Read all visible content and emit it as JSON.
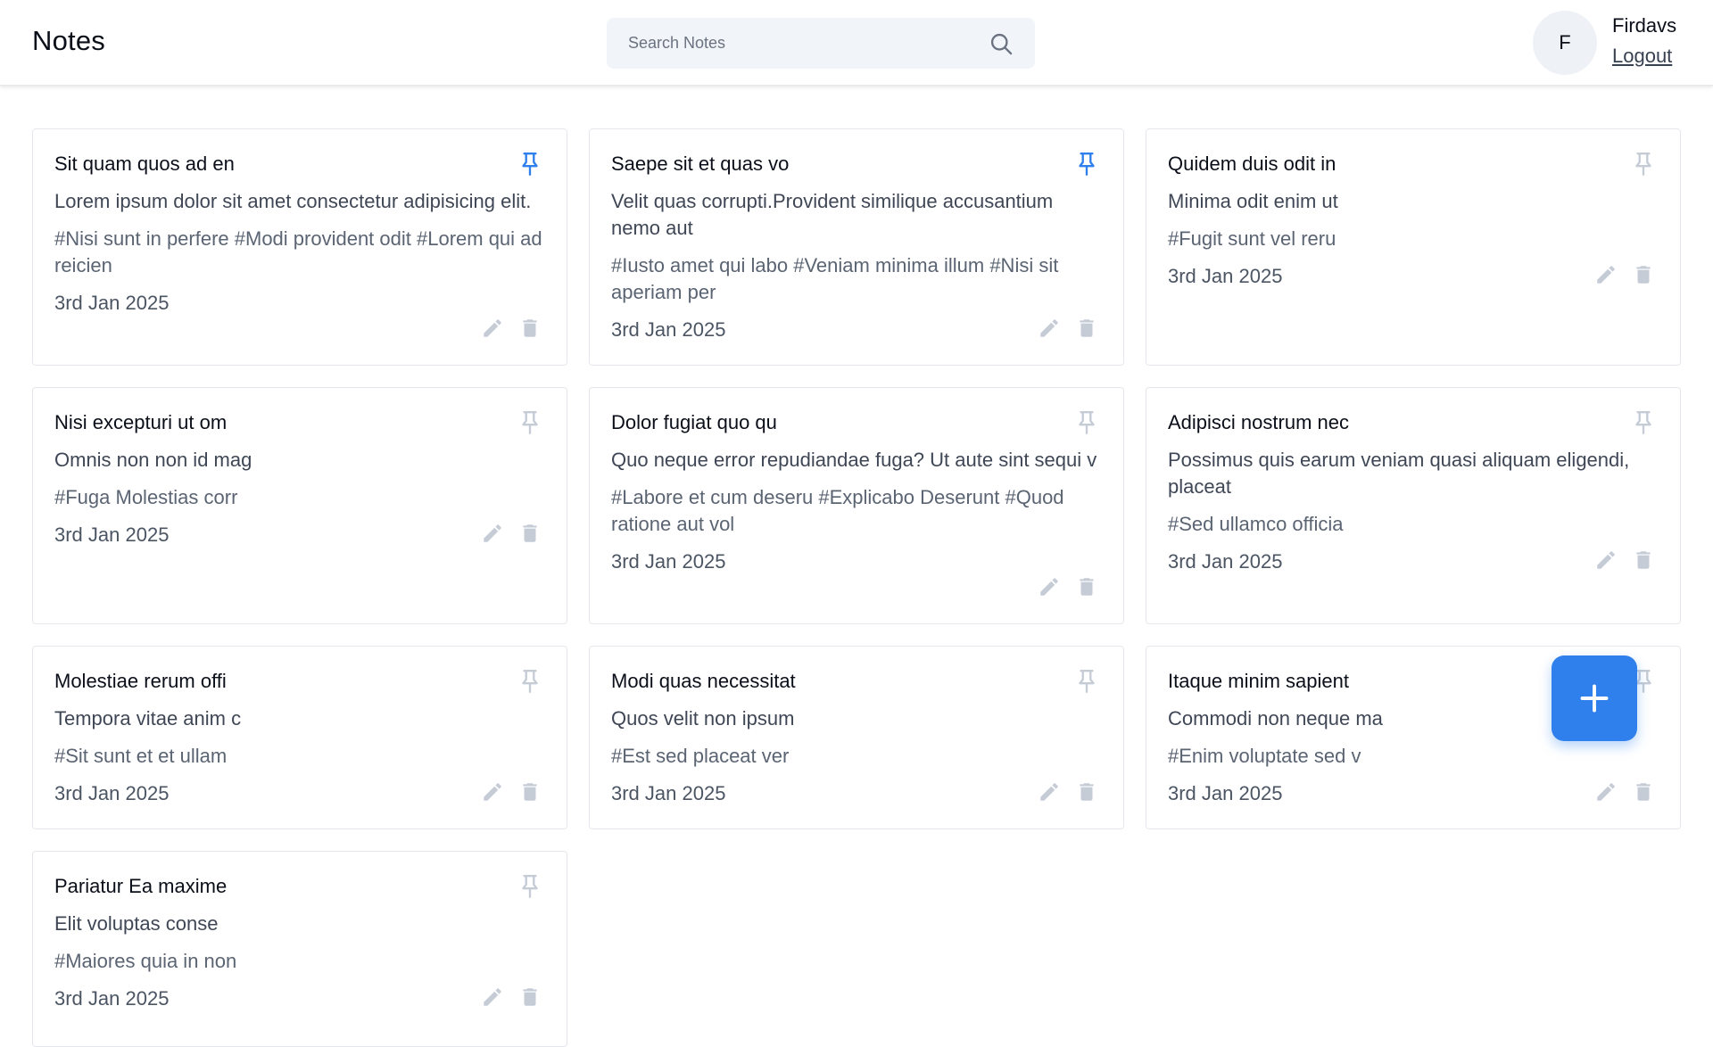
{
  "header": {
    "title": "Notes",
    "search_placeholder": "Search Notes",
    "user": {
      "initial": "F",
      "name": "Firdavs",
      "logout_label": "Logout"
    }
  },
  "colors": {
    "accent": "#2f80ed",
    "pin_active": "#2f80ed",
    "pin_inactive": "#c5ccd6",
    "action_icon": "#c5ccd6"
  },
  "notes": [
    {
      "title": "Sit quam quos ad en",
      "content": "Lorem ipsum dolor sit amet consectetur adipisicing elit.",
      "tags": "#Nisi sunt in perfere #Modi provident odit #Lorem qui ad reicien",
      "date": "3rd Jan 2025",
      "pinned": true
    },
    {
      "title": "Saepe sit et quas vo",
      "content": "Velit quas corrupti.Provident similique accusantium nemo aut",
      "tags": "#Iusto amet qui labo #Veniam minima illum #Nisi sit aperiam per",
      "date": "3rd Jan 2025",
      "pinned": true
    },
    {
      "title": "Quidem duis odit in",
      "content": "Minima odit enim ut",
      "tags": "#Fugit sunt vel reru",
      "date": "3rd Jan 2025",
      "pinned": false
    },
    {
      "title": "Nisi excepturi ut om",
      "content": "Omnis non non id mag",
      "tags": "#Fuga Molestias corr",
      "date": "3rd Jan 2025",
      "pinned": false
    },
    {
      "title": "Dolor fugiat quo qu",
      "content": "Quo neque error repudiandae fuga? Ut aute sint sequi v",
      "tags": "#Labore et cum deseru #Explicabo Deserunt #Quod ratione aut vol",
      "date": "3rd Jan 2025",
      "pinned": false
    },
    {
      "title": "Adipisci nostrum nec",
      "content": "Possimus quis earum veniam quasi aliquam eligendi, placeat",
      "tags": "#Sed ullamco officia",
      "date": "3rd Jan 2025",
      "pinned": false
    },
    {
      "title": "Molestiae rerum offi",
      "content": "Tempora vitae anim c",
      "tags": "#Sit sunt et et ullam",
      "date": "3rd Jan 2025",
      "pinned": false
    },
    {
      "title": "Modi quas necessitat",
      "content": "Quos velit non ipsum",
      "tags": "#Est sed placeat ver",
      "date": "3rd Jan 2025",
      "pinned": false
    },
    {
      "title": "Itaque minim sapient",
      "content": "Commodi non neque ma",
      "tags": "#Enim voluptate sed v",
      "date": "3rd Jan 2025",
      "pinned": false
    },
    {
      "title": "Pariatur Ea maxime",
      "content": "Elit voluptas conse",
      "tags": "#Maiores quia in non",
      "date": "3rd Jan 2025",
      "pinned": false
    }
  ],
  "icons": {
    "search": "search-icon",
    "pin": "pin-icon",
    "edit": "pencil-icon",
    "delete": "trash-icon",
    "add": "plus-icon"
  }
}
